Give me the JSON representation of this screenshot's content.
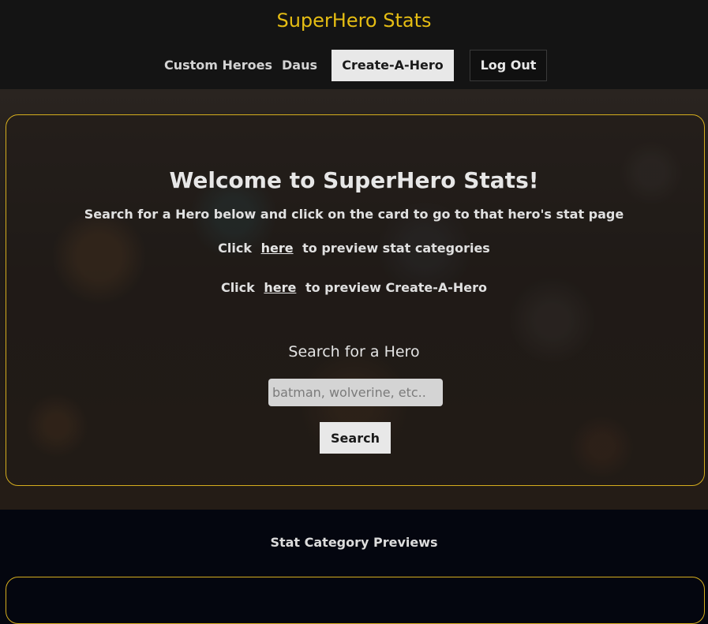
{
  "header": {
    "site_title": "SuperHero Stats",
    "nav": {
      "custom_heroes": "Custom Heroes",
      "username": "Daus",
      "create_a_hero": "Create-A-Hero",
      "log_out": "Log Out"
    }
  },
  "hero": {
    "heading": "Welcome to SuperHero Stats!",
    "instructions": "Search for a Hero below and click on the card to go to that hero's stat page",
    "preview_stats": {
      "prefix": "Click",
      "link": "here",
      "suffix": "to preview stat categories"
    },
    "preview_create": {
      "prefix": "Click",
      "link": "here",
      "suffix": "to preview Create-A-Hero"
    },
    "search": {
      "label": "Search for a Hero",
      "placeholder": "batman, wolverine, etc..",
      "value": "",
      "button": "Search"
    }
  },
  "previews": {
    "title": "Stat Category Previews"
  },
  "colors": {
    "accent": "#e5bd13",
    "card_border": "#d5ad1e",
    "header_bg": "#141414",
    "lower_bg": "#04060f"
  }
}
